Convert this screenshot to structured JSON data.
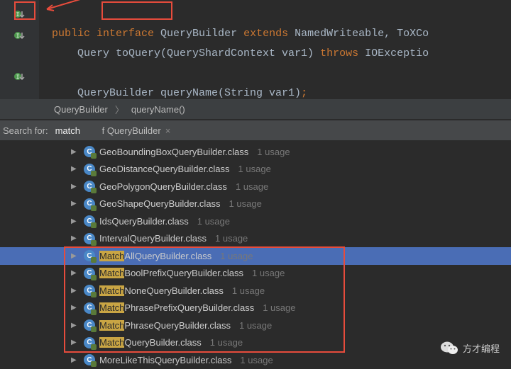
{
  "code": {
    "line1": {
      "public": "public",
      "interface_kw": "interface",
      "rest": " QueryBuilder ",
      "extends_kw": "extends",
      "rest2": " NamedWriteable, ToXCo"
    },
    "line2": {
      "indent": "    Query toQuery(QueryShardContext var1) ",
      "throws_kw": "throws",
      "rest": " IOExceptio"
    },
    "line3": {
      "text": "    QueryBuilder queryName(String var1)",
      "semi": ";"
    }
  },
  "breadcrumb": {
    "a": "QueryBuilder",
    "b": "queryName()"
  },
  "search": {
    "label": "Search for:",
    "value": "match",
    "tab": "f QueryBuilder",
    "close": "×"
  },
  "tree": [
    {
      "name": "GeoBoundingBoxQueryBuilder.class",
      "hl": "",
      "usage": "1 usage",
      "sel": false
    },
    {
      "name": "GeoDistanceQueryBuilder.class",
      "hl": "",
      "usage": "1 usage",
      "sel": false
    },
    {
      "name": "GeoPolygonQueryBuilder.class",
      "hl": "",
      "usage": "1 usage",
      "sel": false
    },
    {
      "name": "GeoShapeQueryBuilder.class",
      "hl": "",
      "usage": "1 usage",
      "sel": false
    },
    {
      "name": "IdsQueryBuilder.class",
      "hl": "",
      "usage": "1 usage",
      "sel": false
    },
    {
      "name": "IntervalQueryBuilder.class",
      "hl": "",
      "usage": "1 usage",
      "sel": false
    },
    {
      "name": "AllQueryBuilder.class",
      "hl": "Match",
      "usage": "1 usage",
      "sel": true
    },
    {
      "name": "BoolPrefixQueryBuilder.class",
      "hl": "Match",
      "usage": "1 usage",
      "sel": false
    },
    {
      "name": "NoneQueryBuilder.class",
      "hl": "Match",
      "usage": "1 usage",
      "sel": false
    },
    {
      "name": "PhrasePrefixQueryBuilder.class",
      "hl": "Match",
      "usage": "1 usage",
      "sel": false
    },
    {
      "name": "PhraseQueryBuilder.class",
      "hl": "Match",
      "usage": "1 usage",
      "sel": false
    },
    {
      "name": "QueryBuilder.class",
      "hl": "Match",
      "usage": "1 usage",
      "sel": false
    },
    {
      "name": "MoreLikeThisQueryBuilder.class",
      "hl": "",
      "usage": "1 usage",
      "sel": false
    }
  ],
  "watermark": "方才编程"
}
